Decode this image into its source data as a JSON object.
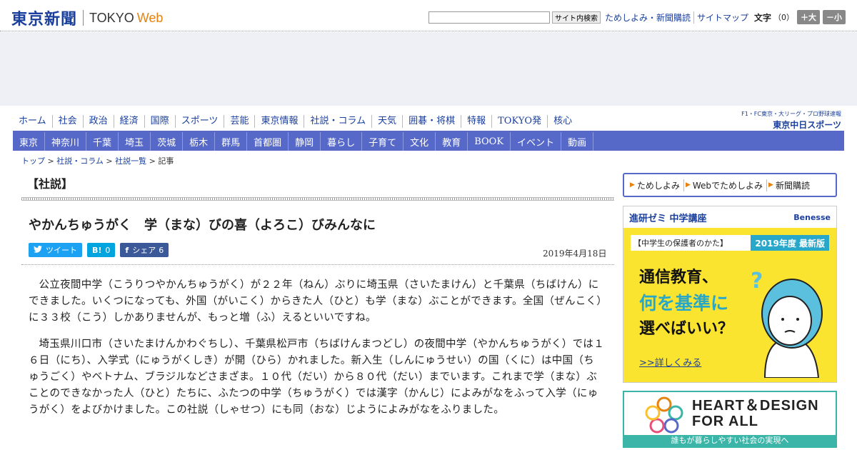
{
  "header": {
    "logo_jp": "東京新聞",
    "logo_en": "TOKYO",
    "logo_web": "Web",
    "search_button": "サイト内検索",
    "links": [
      "ためしよみ・新聞購読",
      "サイトマップ"
    ],
    "font_size_label": "文字",
    "font_size_value": "（0）",
    "font_plus": "＋大",
    "font_minus": "－小"
  },
  "nav_primary": [
    "ホーム",
    "社会",
    "政治",
    "経済",
    "国際",
    "スポーツ",
    "芸能",
    "東京情報",
    "社説・コラム",
    "天気",
    "囲碁・将棋",
    "特報",
    "TOKYO発",
    "核心"
  ],
  "chunichi": {
    "sub": "F1・FC東京・大リーグ・プロ野球速報",
    "main": "東京中日スポーツ"
  },
  "nav_secondary": [
    "東京",
    "神奈川",
    "千葉",
    "埼玉",
    "茨城",
    "栃木",
    "群馬",
    "首都圏",
    "静岡",
    "暮らし",
    "子育て",
    "文化",
    "教育",
    "BOOK",
    "イベント",
    "動画"
  ],
  "breadcrumb": {
    "items": [
      "トップ",
      "社説・コラム",
      "社説一覧"
    ],
    "current": "記事",
    "sep": ">"
  },
  "article": {
    "section": "【社説】",
    "headline": "やかんちゅうがく　学（まな）びの喜（よろこ）びみんなに",
    "date": "2019年4月18日",
    "paragraphs": [
      "公立夜間中学（こうりつやかんちゅうがく）が２２年（ねん）ぶりに埼玉県（さいたまけん）と千葉県（ちばけん）にできました。いくつになっても、外国（がいこく）からきた人（ひと）も学（まな）ぶことができます。全国（ぜんこく）に３３校（こう）しかありませんが、もっと増（ふ）えるといいですね。",
      "埼玉県川口市（さいたまけんかわぐちし）、千葉県松戸市（ちばけんまつどし）の夜間中学（やかんちゅうがく）では１６日（にち）、入学式（にゅうがくしき）が開（ひら）かれました。新入生（しんにゅうせい）の国（くに）は中国（ちゅうごく）やベトナム、ブラジルなどさまざま。１０代（だい）から８０代（だい）までいます。これまで学（まな）ぶことのできなかった人（ひと）たちに、ふたつの中学（ちゅうがく）では漢字（かんじ）によみがなをふって入学（にゅうがく）をよびかけました。この社説（しゃせつ）にも同（おな）じようによみがなをふりました。"
    ]
  },
  "social": {
    "tweet_icon": "twitter-icon",
    "tweet_label": "ツイート",
    "hatena_icon_text": "B!",
    "hatena_count": "0",
    "facebook_icon_text": "f",
    "facebook_label": "シェア",
    "facebook_count": "6"
  },
  "sidebar": {
    "links": [
      "ためしよみ",
      "Webでためしよみ",
      "新聞購読"
    ],
    "ad1": {
      "title": "進研ゼミ 中学講座",
      "brand": "Benesse",
      "band_left": "【中学生の保護者のかた】",
      "band_right": "2019年度 最新版",
      "copy1": "通信教育、",
      "copy2": "何を基準に",
      "copy3": "選べばいい？",
      "link": ">>詳しくみる"
    },
    "ad2": {
      "title1": "HEART＆DESIGN",
      "title2": "FOR ALL",
      "footer": "誰もが暮らしやすい社会の実現へ"
    }
  },
  "colors": {
    "brand_blue": "#1a3f9c",
    "nav_blue": "#5669c9",
    "accent_orange": "#e6820e",
    "ad_yellow": "#fbe42f",
    "ad_teal": "#3ab5a8"
  }
}
